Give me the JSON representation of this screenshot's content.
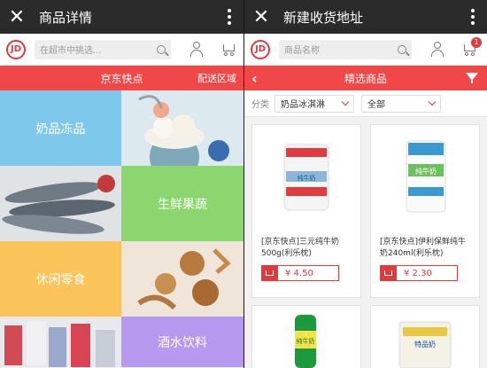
{
  "left": {
    "title": "商品详情",
    "search_placeholder": "在超市中挑选...",
    "logo": "JD",
    "redbar": {
      "title": "京东快点",
      "right": "配送区域"
    },
    "tiles": [
      {
        "label": "奶品冻品",
        "color": "#7ec8ec"
      },
      {
        "label": "",
        "color": "#dce9ee"
      },
      {
        "label": "",
        "color": "#c9ccd0"
      },
      {
        "label": "生鲜果蔬",
        "color": "#8bd66f"
      },
      {
        "label": "休闲零食",
        "color": "#fbc45a"
      },
      {
        "label": "",
        "color": "#e9d9c6"
      },
      {
        "label": "",
        "color": "#e5e6ea"
      },
      {
        "label": "酒水饮料",
        "color": "#b69af0"
      }
    ]
  },
  "right": {
    "title": "新建收货地址",
    "search_placeholder": "商品名称",
    "logo": "JD",
    "cart_badge": "1",
    "redbar": {
      "title": "精选商品"
    },
    "filter": {
      "label": "分类",
      "category": "奶品冰淇淋",
      "sub": "全部"
    },
    "products": [
      {
        "name": "[京东快点]三元纯牛奶500g(利乐枕)",
        "price": "¥ 4.50"
      },
      {
        "name": "[京东快点]伊利保鲜纯牛奶240ml(利乐枕)",
        "price": "¥ 2.30"
      },
      {
        "name": "",
        "price": ""
      },
      {
        "name": "",
        "price": ""
      }
    ],
    "pack_labels": [
      "纯牛奶",
      "纯牛奶",
      "纯牛奶",
      "特品奶"
    ]
  },
  "colors": {
    "brand": "#e4393c",
    "titlebar": "#2b2b2b",
    "redbar": "#f04848"
  }
}
